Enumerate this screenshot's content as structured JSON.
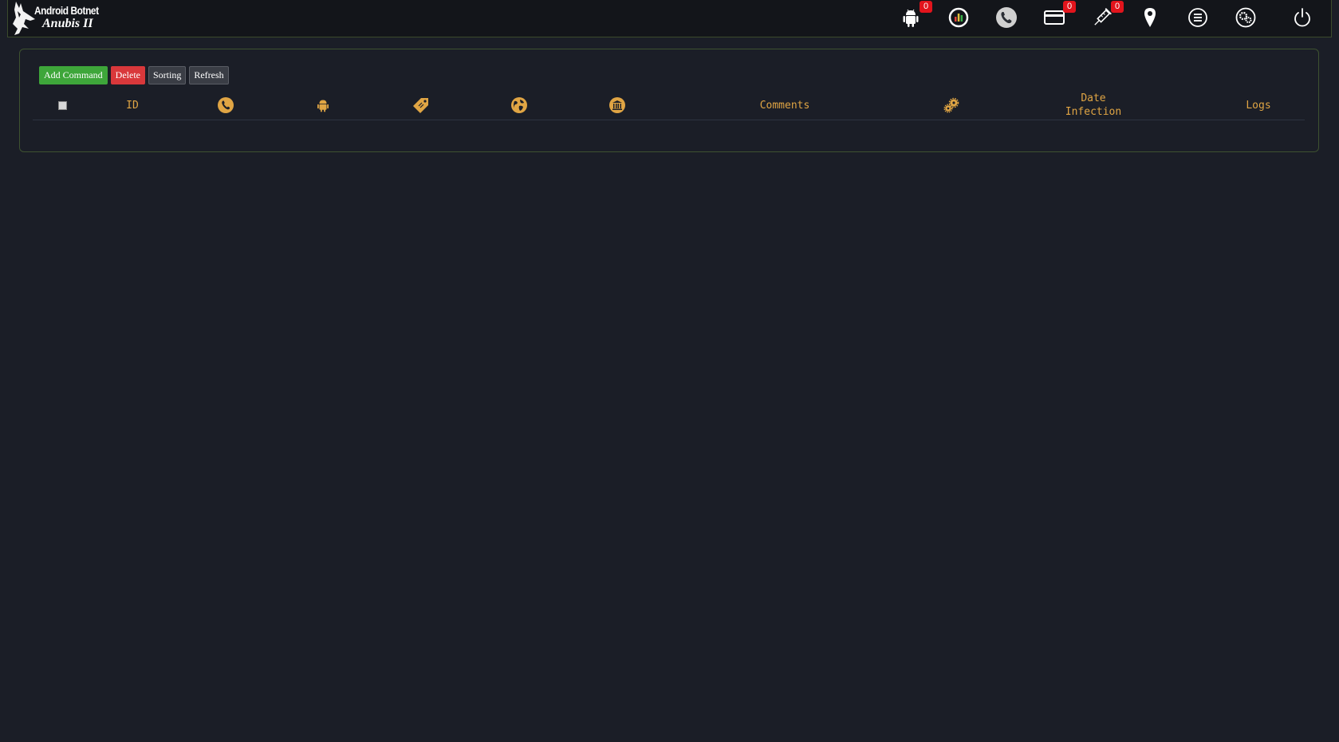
{
  "brand": {
    "line1": "Android Botnet",
    "line2": "Anubis II"
  },
  "nav": [
    {
      "icon": "android-icon",
      "badge": "0"
    },
    {
      "icon": "stats-icon",
      "badge": null
    },
    {
      "icon": "phone-icon",
      "badge": null
    },
    {
      "icon": "card-icon",
      "badge": "0"
    },
    {
      "icon": "injection-icon",
      "badge": "0"
    },
    {
      "icon": "map-pin-icon",
      "badge": null
    },
    {
      "icon": "list-icon",
      "badge": null
    },
    {
      "icon": "settings-icon",
      "badge": null
    },
    {
      "icon": "power-icon",
      "badge": null
    }
  ],
  "toolbar": {
    "add_command": "Add Command",
    "delete": "Delete",
    "sorting": "Sorting",
    "refresh": "Refresh"
  },
  "table": {
    "columns": {
      "id": "ID",
      "comments": "Comments",
      "date_infection": "Date\nInfection",
      "logs": "Logs"
    },
    "rows": []
  },
  "colors": {
    "background": "#1b1e27",
    "topbar": "#13151a",
    "accent_header": "#e0a544",
    "badge": "#e2141c",
    "add_button": "#3ea63a",
    "delete_button": "#d9383b"
  }
}
